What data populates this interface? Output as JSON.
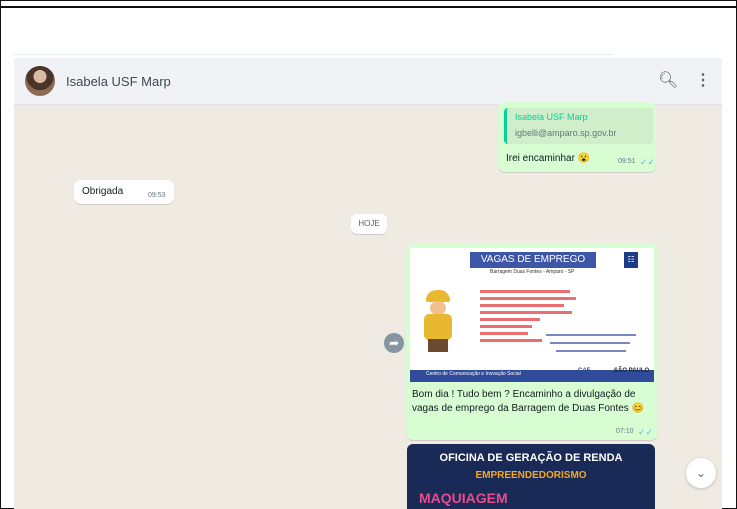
{
  "header": {
    "contact_name": "Isabela USF Marp",
    "search_icon": "search-icon",
    "menu_icon": "menu-icon"
  },
  "messages": {
    "msg1": {
      "quote_name": "Isabela USF Marp",
      "quote_email": "igbelli@amparo.sp.gov.br",
      "text": "Irei encaminhar 😮",
      "time": "09:51"
    },
    "msg2": {
      "text": "Obrigada",
      "time": "09:53"
    },
    "day_separator": "HOJE",
    "msg3": {
      "caption": "Bom dia ! Tudo bem ? Encaminho a divulgação de vagas de emprego da Barragem de Duas Fontes 😊",
      "time": "07:10",
      "poster": {
        "title": "VAGAS DE EMPREGO",
        "subtitle": "Barragem Duas Fontes - Amparo - SP",
        "footer": "Centro de Comunicação e Inovação Social",
        "logos": [
          "CAF",
          "SÃO PAULO"
        ]
      }
    },
    "msg4": {
      "line1": "OFICINA DE GERAÇÃO DE RENDA",
      "line2": "EMPREENDEDORISMO",
      "line3": "MAQUIAGEM"
    }
  },
  "colors": {
    "accent": "#06cf9c",
    "outgoing_bubble": "#d9fdd3",
    "chat_bg": "#efeae2",
    "read_tick": "#53bdeb"
  }
}
